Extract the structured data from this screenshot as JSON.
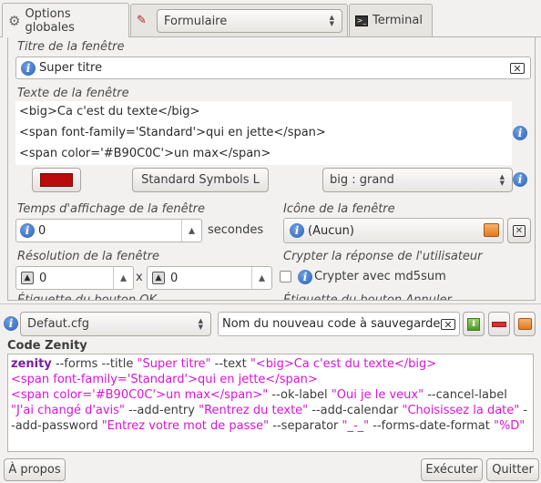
{
  "tabs": [
    {
      "label": "Options globales",
      "icon": "gear-icon"
    },
    {
      "label": "Formulaire",
      "icon": "form-icon"
    },
    {
      "label": "Terminal",
      "icon": "terminal-icon"
    }
  ],
  "tab_combo": {
    "value": "Formulaire"
  },
  "title_field": {
    "label": "Titre de la fenêtre",
    "value": "Super titre"
  },
  "text_field": {
    "label": "Texte de la fenêtre",
    "lines": [
      "<big>Ca c'est du texte</big>",
      "<span font-family='Standard'>qui en jette</span>",
      "<span color='#B90C0C'>un max</span>"
    ]
  },
  "color_swatch": "#B90C0C",
  "font_button": {
    "label": "Standard Symbols L"
  },
  "size_combo": {
    "value": "big : grand"
  },
  "timeout": {
    "label": "Temps d'affichage de la fenêtre",
    "value": "0",
    "unit": "secondes"
  },
  "icon_field": {
    "label": "Icône de la fenêtre",
    "value": "(Aucun)"
  },
  "resolution": {
    "label": "Résolution de la fenêtre",
    "width": "0",
    "separator": "x",
    "height": "0"
  },
  "encrypt": {
    "label": "Crypter la réponse de l'utilisateur",
    "checkbox_label": "Crypter avec md5sum",
    "checked": false
  },
  "cut_labels": {
    "left": "Étiquette du bouton OK",
    "right": "Étiquette du bouton Annuler"
  },
  "config": {
    "combo_value": "Defaut.cfg",
    "new_code_placeholder": "Nom du nouveau code à sauvegarder"
  },
  "code": {
    "title": "Code Zenity",
    "tokens": [
      {
        "t": "zenity",
        "c": "kw"
      },
      {
        "t": " --forms --title ",
        "c": ""
      },
      {
        "t": "\"Super titre\"",
        "c": "str"
      },
      {
        "t": " --text ",
        "c": ""
      },
      {
        "t": "\"<big>Ca c'est du texte</big>",
        "c": "str"
      },
      {
        "t": "\n",
        "c": ""
      },
      {
        "t": "<span font-family='Standard'>qui en jette</span>",
        "c": "str"
      },
      {
        "t": "\n",
        "c": ""
      },
      {
        "t": "<span color='#B90C0C'>un max</span>\"",
        "c": "str"
      },
      {
        "t": " --ok-label ",
        "c": ""
      },
      {
        "t": "\"Oui je le veux\"",
        "c": "str"
      },
      {
        "t": " --cancel-label ",
        "c": ""
      },
      {
        "t": "\"J'ai changé d'avis\"",
        "c": "str"
      },
      {
        "t": " --add-entry ",
        "c": ""
      },
      {
        "t": "\"Rentrez du texte\"",
        "c": "str"
      },
      {
        "t": " --add-calendar ",
        "c": ""
      },
      {
        "t": "\"Choisissez la date\"",
        "c": "str"
      },
      {
        "t": " --add-password ",
        "c": ""
      },
      {
        "t": "\"Entrez votre mot de passe\"",
        "c": "str"
      },
      {
        "t": " --separator ",
        "c": ""
      },
      {
        "t": "\"_-_\"",
        "c": "str"
      },
      {
        "t": " --forms-date-format ",
        "c": ""
      },
      {
        "t": "\"%D\"",
        "c": "str"
      }
    ]
  },
  "footer": {
    "about": "À propos",
    "execute": "Exécuter",
    "quit": "Quitter"
  }
}
